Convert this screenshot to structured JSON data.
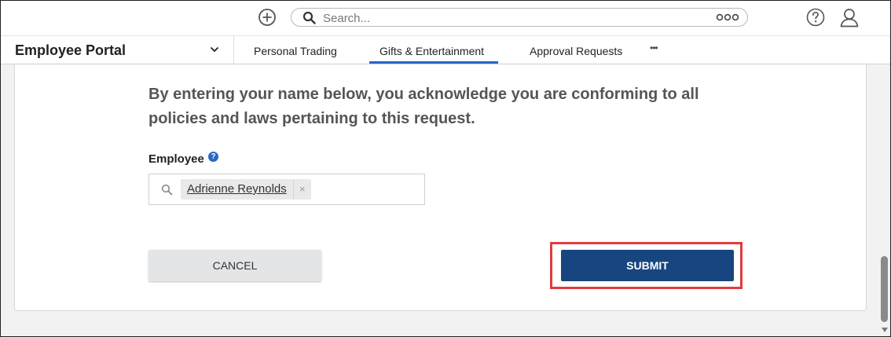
{
  "topbar": {
    "add_icon": "plus-circle-icon",
    "search": {
      "placeholder": "Search...",
      "value": ""
    },
    "more_icon": "more-dots-icon",
    "help_icon": "question-circle-icon",
    "user_icon": "user-profile-icon"
  },
  "navbar": {
    "portal_label": "Employee Portal",
    "portal_caret_icon": "chevron-down-icon",
    "tabs": [
      {
        "label": "Personal Trading",
        "active": false
      },
      {
        "label": "Gifts & Entertainment",
        "active": true
      },
      {
        "label": "Approval Requests",
        "active": false
      }
    ],
    "more_label": "•••"
  },
  "form": {
    "acknowledgement": "By entering your name below, you acknowledge you are conforming to all policies and laws pertaining to this request.",
    "employee_label": "Employee",
    "employee_help_icon": "question-circle-icon",
    "employee_help_glyph": "?",
    "employee_search_icon": "search-icon",
    "selected_employee": "Adrienne Reynolds",
    "remove_chip_glyph": "×",
    "cancel_label": "CANCEL",
    "submit_label": "SUBMIT"
  },
  "colors": {
    "accent": "#2a66c9",
    "submit_bg": "#17457f",
    "highlight": "#e23b3b"
  }
}
